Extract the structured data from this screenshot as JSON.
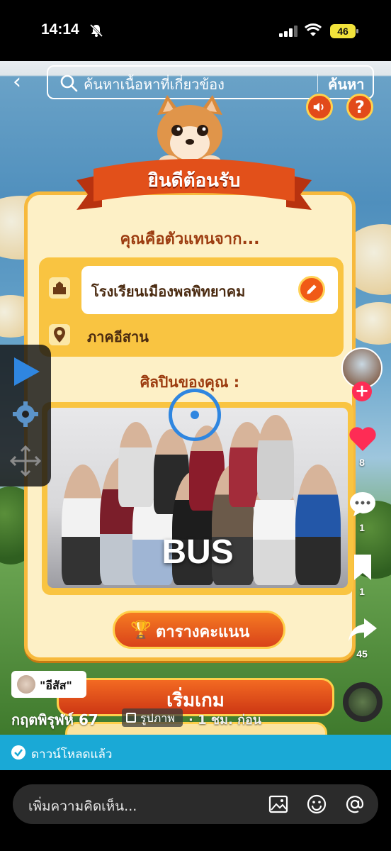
{
  "status_bar": {
    "time": "14:14",
    "battery": "46"
  },
  "search": {
    "placeholder": "ค้นหาเนื้อหาที่เกี่ยวข้อง",
    "submit_label": "ค้นหา"
  },
  "game": {
    "welcome_banner": "ยินดีต้อนรับ",
    "subtitle": "คุณคือตัวแทนจาก...",
    "school_name": "โรงเรียนเมืองพลพิทยาคม",
    "region": "ภาคอีสาน",
    "artist_label": "ศิลปินของคุณ :",
    "artist_name": "BUS",
    "leaderboard_label": "ตารางคะแนน",
    "start_label": "เริ่มเกม"
  },
  "rail": {
    "likes": "8",
    "comments": "1",
    "saves": "1",
    "shares": "45"
  },
  "post": {
    "tag_text": "\"อีสัส\"",
    "author": "กฤตพิรุฬห์ 67",
    "media_type": "รูปภาพ",
    "time_ago": "· 1 ชม. ก่อน"
  },
  "download_banner": "ดาวน์โหลดแล้ว",
  "comment": {
    "placeholder": "เพิ่มความคิดเห็น..."
  },
  "colors": {
    "accent": "#fe2c55",
    "download_bar": "#1aa9d6",
    "button_orange": "#e2501a",
    "card": "#fdf0c6"
  }
}
